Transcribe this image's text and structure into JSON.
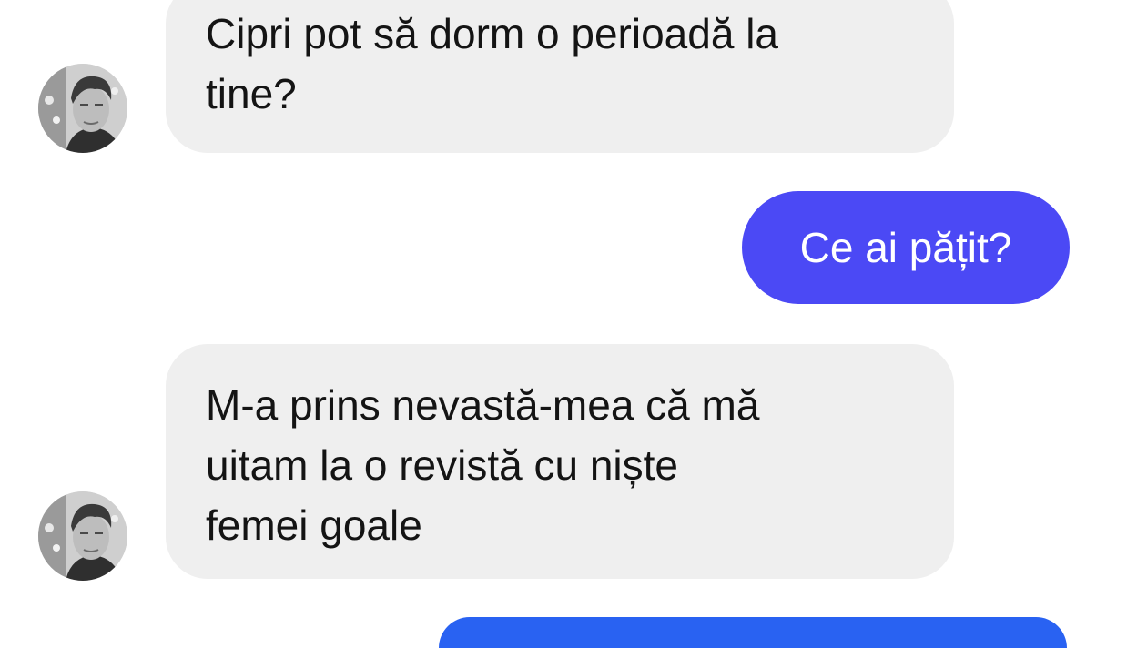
{
  "colors": {
    "incoming_bubble": "#efefef",
    "incoming_text": "#141414",
    "outgoing_bubble_1": "#4b49f5",
    "outgoing_bubble_2": "#2962f2",
    "outgoing_text": "#ffffff"
  },
  "conversation": {
    "messages": [
      {
        "direction": "incoming",
        "avatar_icon": "user-avatar-icon",
        "lines": [
          "Cipri pot să dorm o perioadă la",
          "tine?"
        ]
      },
      {
        "direction": "outgoing",
        "lines": [
          "Ce ai pățit?"
        ]
      },
      {
        "direction": "incoming",
        "avatar_icon": "user-avatar-icon",
        "lines": [
          "M-a prins nevastă-mea că mă",
          "uitam la o revistă cu niște",
          "femei goale"
        ]
      },
      {
        "direction": "outgoing",
        "lines": []
      }
    ]
  }
}
